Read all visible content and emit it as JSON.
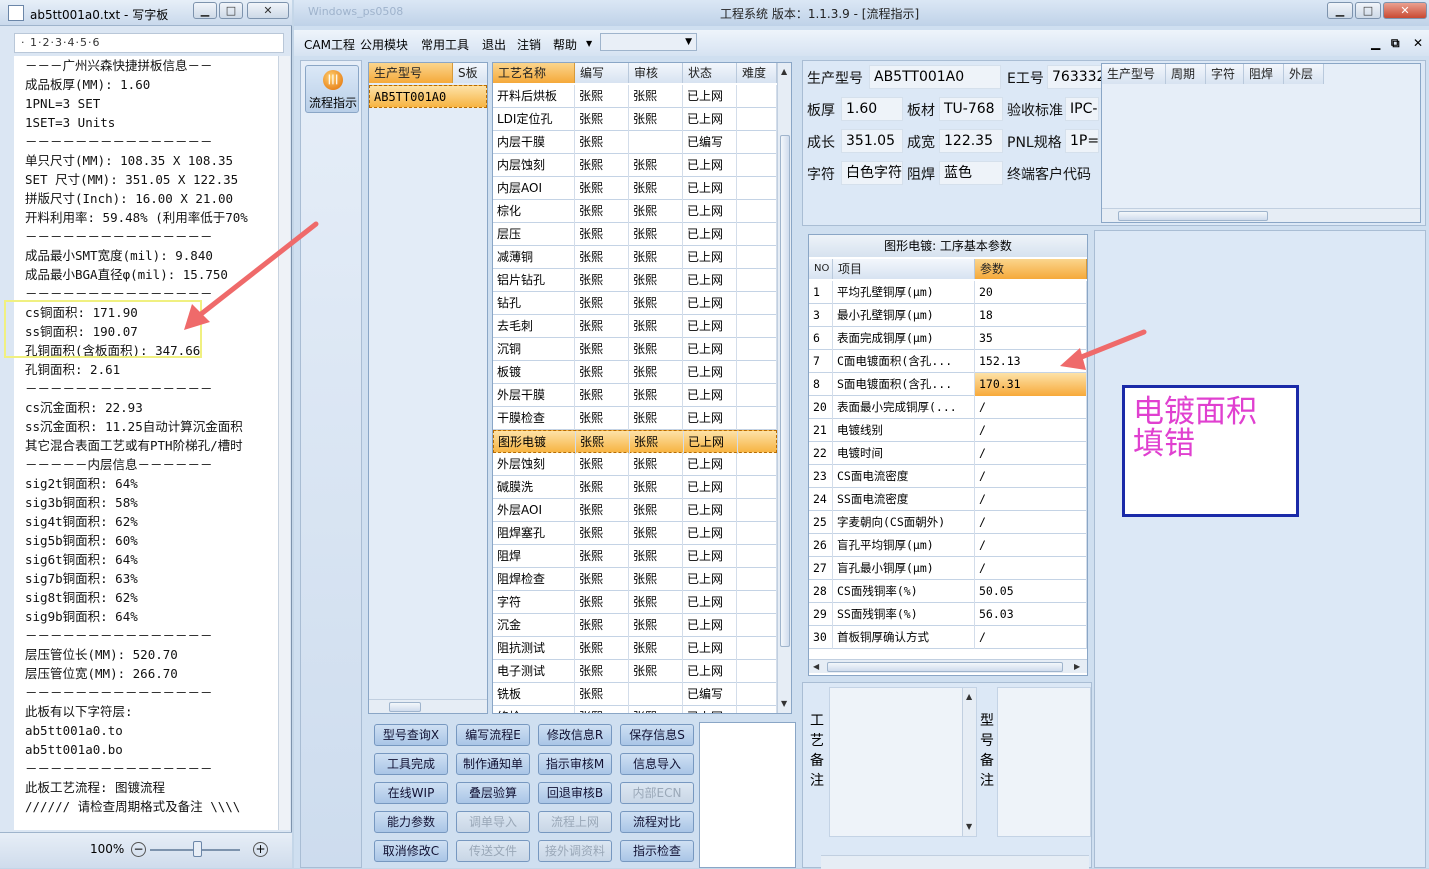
{
  "notepad": {
    "title": "ab5tt001a0.txt - 写字板",
    "ruler": "1·2·3·4·5·6",
    "zoom": "100%",
    "lines": [
      "－－－广州兴森快捷拼板信息－－",
      "成品板厚(MM): 1.60",
      "1PNL=3 SET",
      "1SET=3 Units",
      "－－－－－－－－－－－－－－－",
      "单只尺寸(MM): 108.35 X 108.35",
      "SET 尺寸(MM): 351.05 X 122.35",
      "拼版尺寸(Inch): 16.00 X 21.00",
      "开料利用率: 59.48% (利用率低于70%",
      "－－－－－－－－－－－－－－－",
      "成品最小SMT宽度(mil): 9.840",
      "成品最小BGA直径φ(mil): 15.750",
      "－－－－－－－－－－－－－－－",
      "cs铜面积: 171.90",
      "ss铜面积: 190.07",
      "孔铜面积(含板面积): 347.66",
      "孔铜面积: 2.61",
      "－－－－－－－－－－－－－－－",
      "cs沉金面积: 22.93",
      "ss沉金面积: 11.25自动计算沉金面积",
      "其它混合表面工艺或有PTH阶梯孔/槽时",
      "－－－－－内层信息－－－－－－",
      "sig2t铜面积: 64%",
      "sig3b铜面积: 58%",
      "sig4t铜面积: 62%",
      "sig5b铜面积: 60%",
      "sig6t铜面积: 64%",
      "sig7b铜面积: 63%",
      "sig8t铜面积: 62%",
      "sig9b铜面积: 64%",
      "－－－－－－－－－－－－－－－",
      "层压管位长(MM): 520.70",
      "层压管位宽(MM): 266.70",
      "－－－－－－－－－－－－－－－",
      "此板有以下字符层:",
      "ab5tt001a0.to",
      "ab5tt001a0.bo",
      "－－－－－－－－－－－－－－－",
      "此板工艺流程: 图镀流程",
      "////// 请检查周期格式及备注 \\\\\\\\"
    ]
  },
  "app": {
    "title": "工程系统  版本：1.1.3.9 - [流程指示]",
    "ghost_title": "Windows_ps0508",
    "menu": [
      "CAM工程",
      "公用模块",
      "常用工具",
      "退出",
      "注销",
      "帮助"
    ],
    "nav_label": "流程指示",
    "model_grid": {
      "headers": [
        "生产型号",
        "S板"
      ],
      "rows": [
        "AB5TT001A0"
      ]
    },
    "process_grid": {
      "headers": [
        "工艺名称",
        "编写",
        "审核",
        "状态",
        "难度"
      ],
      "rows": [
        [
          "开料后烘板",
          "张熙",
          "张熙",
          "已上网"
        ],
        [
          "LDI定位孔",
          "张熙",
          "张熙",
          "已上网"
        ],
        [
          "内层干膜",
          "张熙",
          "",
          "已编写"
        ],
        [
          "内层蚀刻",
          "张熙",
          "张熙",
          "已上网"
        ],
        [
          "内层AOI",
          "张熙",
          "张熙",
          "已上网"
        ],
        [
          "棕化",
          "张熙",
          "张熙",
          "已上网"
        ],
        [
          "层压",
          "张熙",
          "张熙",
          "已上网"
        ],
        [
          "减薄铜",
          "张熙",
          "张熙",
          "已上网"
        ],
        [
          "铝片钻孔",
          "张熙",
          "张熙",
          "已上网"
        ],
        [
          "钻孔",
          "张熙",
          "张熙",
          "已上网"
        ],
        [
          "去毛刺",
          "张熙",
          "张熙",
          "已上网"
        ],
        [
          "沉铜",
          "张熙",
          "张熙",
          "已上网"
        ],
        [
          "板镀",
          "张熙",
          "张熙",
          "已上网"
        ],
        [
          "外层干膜",
          "张熙",
          "张熙",
          "已上网"
        ],
        [
          "干膜检查",
          "张熙",
          "张熙",
          "已上网"
        ],
        [
          "图形电镀",
          "张熙",
          "张熙",
          "已上网"
        ],
        [
          "外层蚀刻",
          "张熙",
          "张熙",
          "已上网"
        ],
        [
          "碱膜洗",
          "张熙",
          "张熙",
          "已上网"
        ],
        [
          "外层AOI",
          "张熙",
          "张熙",
          "已上网"
        ],
        [
          "阻焊塞孔",
          "张熙",
          "张熙",
          "已上网"
        ],
        [
          "阻焊",
          "张熙",
          "张熙",
          "已上网"
        ],
        [
          "阻焊检查",
          "张熙",
          "张熙",
          "已上网"
        ],
        [
          "字符",
          "张熙",
          "张熙",
          "已上网"
        ],
        [
          "沉金",
          "张熙",
          "张熙",
          "已上网"
        ],
        [
          "阻抗测试",
          "张熙",
          "张熙",
          "已上网"
        ],
        [
          "电子测试",
          "张熙",
          "张熙",
          "已上网"
        ],
        [
          "铣板",
          "张熙",
          "",
          "已编写"
        ],
        [
          "终检",
          "张熙",
          "张熙",
          "已上网"
        ]
      ]
    },
    "info": {
      "model_label": "生产型号",
      "model_value": "AB5TT001A0",
      "e_label": "E工号",
      "e_value": "763332",
      "thick_label": "板厚",
      "thick_value": "1.60",
      "mat_label": "板材",
      "mat_value": "TU-768",
      "std_label": "验收标准",
      "std_value": "IPC-",
      "len_label": "成长",
      "len_value": "351.05",
      "wid_label": "成宽",
      "wid_value": "122.35",
      "pnl_label": "PNL规格",
      "pnl_value": "1P=",
      "char_label": "字符",
      "char_value": "白色字符",
      "mask_label": "阻焊",
      "mask_value": "蓝色",
      "cust_label": "终端客户代码"
    },
    "right_grid_headers": [
      "生产型号",
      "周期",
      "字符",
      "阻焊",
      "外层"
    ],
    "param_grid": {
      "title": "图形电镀: 工序基本参数",
      "headers": [
        "NO",
        "项目",
        "参数"
      ],
      "rows": [
        [
          "1",
          "平均孔壁铜厚(μm)",
          "20"
        ],
        [
          "3",
          "最小孔壁铜厚(μm)",
          "18"
        ],
        [
          "6",
          "表面完成铜厚(μm)",
          "35"
        ],
        [
          "7",
          "C面电镀面积(含孔...",
          "152.13"
        ],
        [
          "8",
          "S面电镀面积(含孔...",
          "170.31"
        ],
        [
          "20",
          "表面最小完成铜厚(...",
          "/"
        ],
        [
          "21",
          "电镀线别",
          "/"
        ],
        [
          "22",
          "电镀时间",
          "/"
        ],
        [
          "23",
          "CS面电流密度",
          "/"
        ],
        [
          "24",
          "SS面电流密度",
          "/"
        ],
        [
          "25",
          "字麦朝向(CS面朝外)",
          "/"
        ],
        [
          "26",
          "盲孔平均铜厚(μm)",
          "/"
        ],
        [
          "27",
          "盲孔最小铜厚(μm)",
          "/"
        ],
        [
          "28",
          "CS面残铜率(%)",
          "50.05"
        ],
        [
          "29",
          "SS面残铜率(%)",
          "56.03"
        ],
        [
          "30",
          "首板铜厚确认方式",
          "/"
        ]
      ]
    },
    "annotation": "电镀面积\n填错",
    "remarks": {
      "process": "工艺备注",
      "model": "型号备注"
    },
    "buttons": [
      [
        "型号查询X",
        "编写流程E",
        "修改信息R",
        "保存信息S"
      ],
      [
        "工具完成",
        "制作通知单",
        "指示审核M",
        "信息导入"
      ],
      [
        "在线WIP",
        "叠层验算",
        "回退审核B",
        "内部ECN"
      ],
      [
        "能力参数",
        "调单导入",
        "流程上网",
        "流程对比"
      ],
      [
        "取消修改C",
        "传送文件",
        "接外调资料",
        "指示检查"
      ]
    ],
    "disabled_buttons": [
      "内部ECN",
      "调单导入",
      "流程上网",
      "传送文件",
      "接外调资料"
    ],
    "colors": {
      "accent": "#f5a93a",
      "annotation_text": "#e040d0",
      "annotation_border": "#1a2aa8",
      "arrow": "#ef6a6a",
      "highlight_box": "#f0f080"
    }
  }
}
